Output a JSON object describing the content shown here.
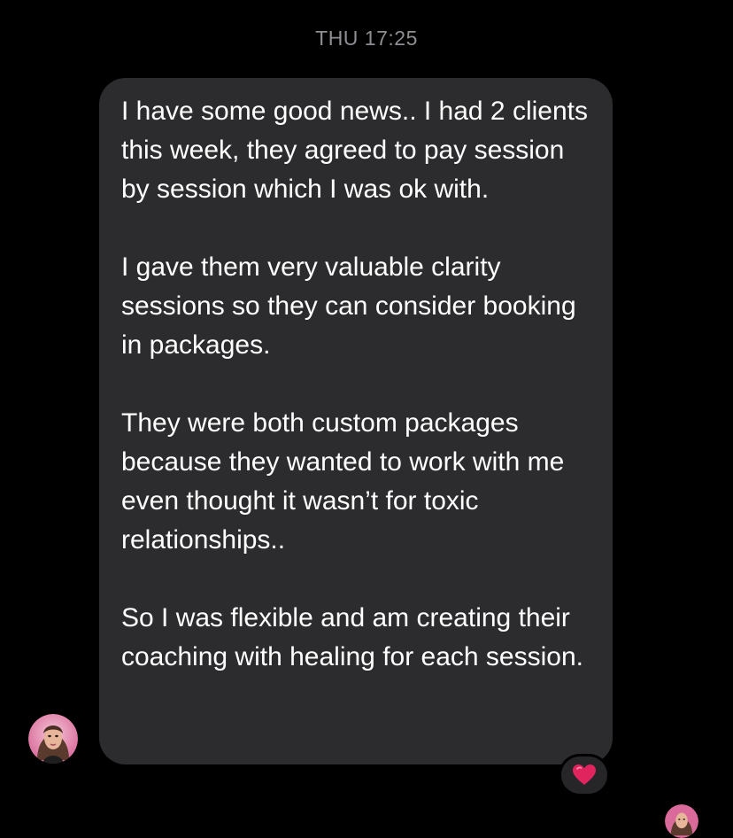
{
  "conversation": {
    "timestamp": "THU 17:25"
  },
  "message": {
    "sender_avatar_icon": "profile-avatar-icon",
    "paragraphs": [
      "I have some good news.. I had 2 clients this week, they agreed to pay session by session which I was ok with.",
      "I gave them very valuable clarity sessions so they can consider booking in packages.",
      "They were both custom packages because they wanted to work with me even thought it wasn’t for toxic relationships..",
      "So I was flexible and am creating their coaching with healing for each session."
    ],
    "reaction": {
      "icon": "red-heart-icon",
      "color": "#e0245e"
    }
  },
  "read_receipt": {
    "icon": "seen-avatar-icon"
  },
  "colors": {
    "background": "#000000",
    "bubble": "#2c2c2e",
    "text": "#ffffff",
    "timestamp": "#8e8e93"
  }
}
